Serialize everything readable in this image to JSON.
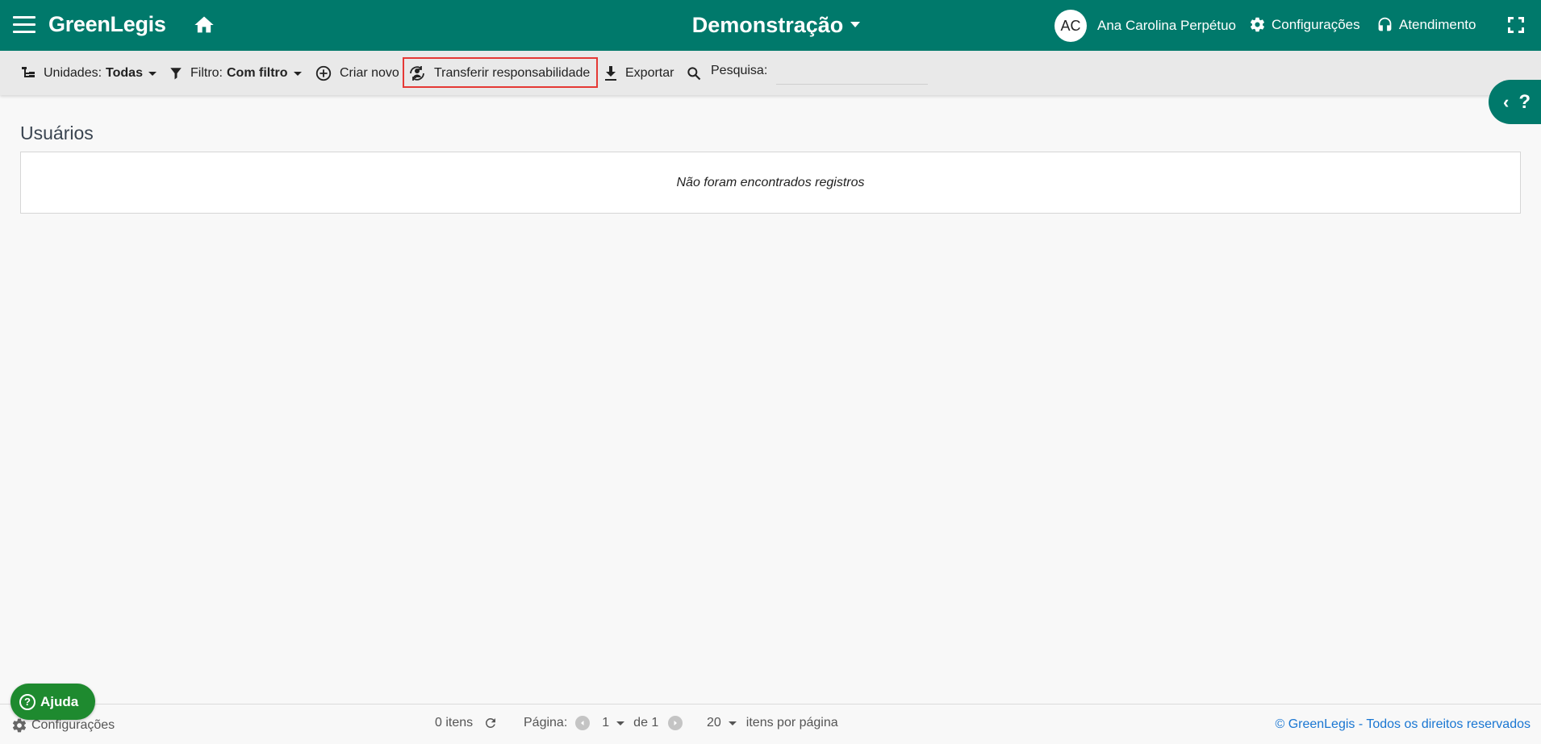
{
  "header": {
    "app_name": "GreenLegis",
    "workspace": "Demonstração",
    "user_initials": "AC",
    "user_name": "Ana Carolina Perpétuo",
    "settings_label": "Configurações",
    "support_label": "Atendimento"
  },
  "toolbar": {
    "units_label": "Unidades:",
    "units_value": "Todas",
    "filter_label": "Filtro:",
    "filter_value": "Com filtro",
    "create_label": "Criar novo",
    "transfer_label": "Transferir responsabilidade",
    "export_label": "Exportar",
    "search_label": "Pesquisa:",
    "search_value": ""
  },
  "main": {
    "title": "Usuários",
    "empty_message": "Não foram encontrados registros"
  },
  "footer": {
    "settings_label": "Configurações",
    "help_label": "Ajuda",
    "items_count": "0 itens",
    "page_label": "Página:",
    "page_current": "1",
    "page_of": "de 1",
    "per_page": "20",
    "per_page_label": "itens por página",
    "copyright": "© GreenLegis - Todos os direitos reservados"
  },
  "colors": {
    "primary": "#00796b",
    "help_button": "#1e8a2f",
    "highlight": "#e53935",
    "link": "#1976d2"
  },
  "icons": [
    "menu-icon",
    "home-icon",
    "gear-icon",
    "headset-icon",
    "fullscreen-icon",
    "tree-icon",
    "filter-icon",
    "plus-circle-icon",
    "transfer-icon",
    "download-icon",
    "search-icon",
    "refresh-icon",
    "chevron-left-icon",
    "question-icon"
  ]
}
